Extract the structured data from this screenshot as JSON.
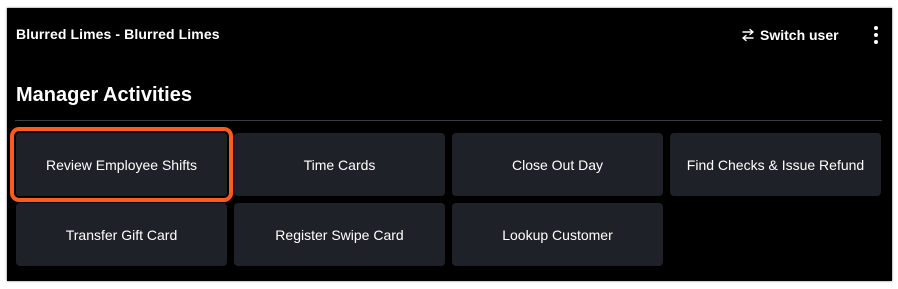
{
  "header": {
    "store_name": "Blurred Limes - Blurred Limes",
    "switch_user_label": "Switch user",
    "switch_icon": "swap-arrows-icon",
    "menu_icon": "more-vertical-icon"
  },
  "section": {
    "title": "Manager Activities"
  },
  "activities": [
    {
      "label": "Review Employee Shifts",
      "highlighted": true
    },
    {
      "label": "Time Cards"
    },
    {
      "label": "Close Out Day"
    },
    {
      "label": "Find Checks & Issue Refund"
    },
    {
      "label": "Transfer Gift Card"
    },
    {
      "label": "Register Swipe Card"
    },
    {
      "label": "Lookup Customer"
    }
  ],
  "colors": {
    "background": "#000000",
    "tile": "#1e2127",
    "highlight": "#ff5a1f",
    "text": "#ffffff"
  }
}
